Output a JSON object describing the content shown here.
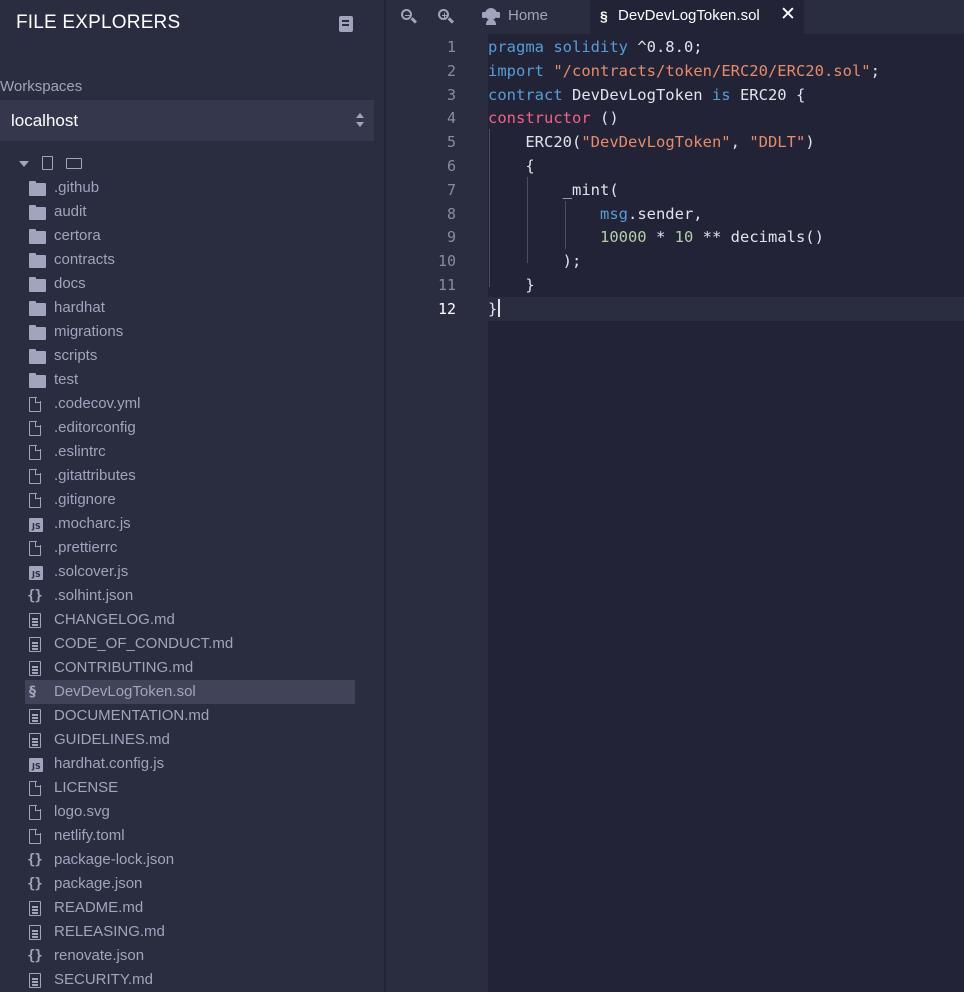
{
  "sidebar": {
    "title": "FILE EXPLORERS",
    "workspaces_label": "Workspaces",
    "workspace_selected": "localhost",
    "files": [
      {
        "name": ".github",
        "icon": "folder"
      },
      {
        "name": "audit",
        "icon": "folder"
      },
      {
        "name": "certora",
        "icon": "folder"
      },
      {
        "name": "contracts",
        "icon": "folder"
      },
      {
        "name": "docs",
        "icon": "folder"
      },
      {
        "name": "hardhat",
        "icon": "folder"
      },
      {
        "name": "migrations",
        "icon": "folder"
      },
      {
        "name": "scripts",
        "icon": "folder"
      },
      {
        "name": "test",
        "icon": "folder"
      },
      {
        "name": ".codecov.yml",
        "icon": "file"
      },
      {
        "name": ".editorconfig",
        "icon": "file"
      },
      {
        "name": ".eslintrc",
        "icon": "file"
      },
      {
        "name": ".gitattributes",
        "icon": "file"
      },
      {
        "name": ".gitignore",
        "icon": "file"
      },
      {
        "name": ".mocharc.js",
        "icon": "js"
      },
      {
        "name": ".prettierrc",
        "icon": "file"
      },
      {
        "name": ".solcover.js",
        "icon": "js"
      },
      {
        "name": ".solhint.json",
        "icon": "json"
      },
      {
        "name": "CHANGELOG.md",
        "icon": "md"
      },
      {
        "name": "CODE_OF_CONDUCT.md",
        "icon": "md"
      },
      {
        "name": "CONTRIBUTING.md",
        "icon": "md"
      },
      {
        "name": "DevDevLogToken.sol",
        "icon": "sol",
        "selected": true
      },
      {
        "name": "DOCUMENTATION.md",
        "icon": "md"
      },
      {
        "name": "GUIDELINES.md",
        "icon": "md"
      },
      {
        "name": "hardhat.config.js",
        "icon": "js"
      },
      {
        "name": "LICENSE",
        "icon": "file"
      },
      {
        "name": "logo.svg",
        "icon": "file"
      },
      {
        "name": "netlify.toml",
        "icon": "file"
      },
      {
        "name": "package-lock.json",
        "icon": "json"
      },
      {
        "name": "package.json",
        "icon": "json"
      },
      {
        "name": "README.md",
        "icon": "md"
      },
      {
        "name": "RELEASING.md",
        "icon": "md"
      },
      {
        "name": "renovate.json",
        "icon": "json"
      },
      {
        "name": "SECURITY.md",
        "icon": "md"
      }
    ]
  },
  "tabs": {
    "home_label": "Home",
    "active_label": "DevDevLogToken.sol",
    "close_glyph": "✕"
  },
  "editor": {
    "current_line": 12,
    "lines": [
      [
        {
          "t": "pragma solidity",
          "c": "kw"
        },
        {
          "t": " ^0.8.0;",
          "c": "plain"
        }
      ],
      [
        {
          "t": "import",
          "c": "kw"
        },
        {
          "t": " ",
          "c": "plain"
        },
        {
          "t": "\"/contracts/token/ERC20/ERC20.sol\"",
          "c": "str"
        },
        {
          "t": ";",
          "c": "plain"
        }
      ],
      [
        {
          "t": "contract",
          "c": "kw"
        },
        {
          "t": " DevDevLogToken ",
          "c": "plain"
        },
        {
          "t": "is",
          "c": "kw"
        },
        {
          "t": " ERC20 {",
          "c": "plain"
        }
      ],
      [
        {
          "t": "constructor",
          "c": "kw2"
        },
        {
          "t": " ()",
          "c": "plain"
        }
      ],
      [
        {
          "t": "    ERC20(",
          "c": "plain"
        },
        {
          "t": "\"DevDevLogToken\"",
          "c": "str"
        },
        {
          "t": ", ",
          "c": "plain"
        },
        {
          "t": "\"DDLT\"",
          "c": "str"
        },
        {
          "t": ")",
          "c": "plain"
        }
      ],
      [
        {
          "t": "    {",
          "c": "plain"
        }
      ],
      [
        {
          "t": "        _mint(",
          "c": "plain"
        }
      ],
      [
        {
          "t": "            ",
          "c": "plain"
        },
        {
          "t": "msg",
          "c": "kw"
        },
        {
          "t": ".sender,",
          "c": "plain"
        }
      ],
      [
        {
          "t": "            ",
          "c": "plain"
        },
        {
          "t": "10000",
          "c": "num"
        },
        {
          "t": " * ",
          "c": "plain"
        },
        {
          "t": "10",
          "c": "num"
        },
        {
          "t": " ** decimals()",
          "c": "plain"
        }
      ],
      [
        {
          "t": "        );",
          "c": "plain"
        }
      ],
      [
        {
          "t": "    }",
          "c": "plain"
        }
      ],
      [
        {
          "t": "}",
          "c": "plain"
        }
      ]
    ]
  }
}
